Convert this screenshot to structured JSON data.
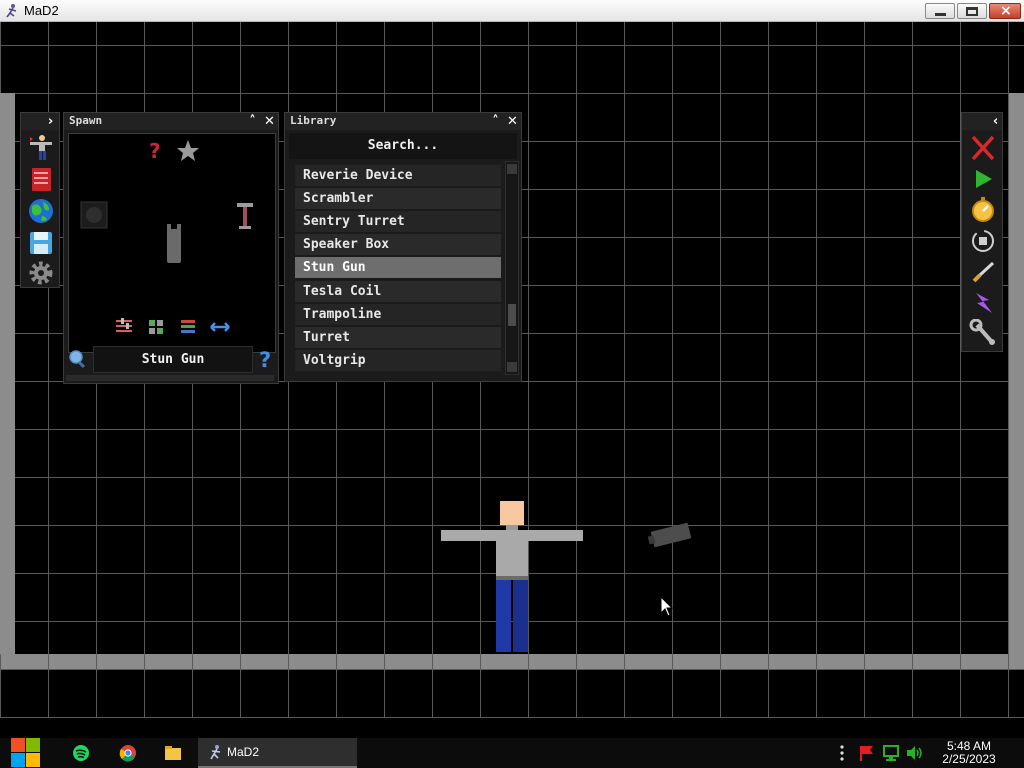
{
  "window": {
    "title": "MaD2"
  },
  "spawn_panel": {
    "title": "Spawn",
    "selected_name": "Stun Gun"
  },
  "library_panel": {
    "title": "Library",
    "search_placeholder": "Search...",
    "items": [
      {
        "label": "Reverie Device"
      },
      {
        "label": "Scrambler"
      },
      {
        "label": "Sentry Turret"
      },
      {
        "label": "Speaker Box"
      },
      {
        "label": "Stun Gun",
        "selected": true
      },
      {
        "label": "Tesla Coil"
      },
      {
        "label": "Trampoline"
      },
      {
        "label": "Turret"
      },
      {
        "label": "Voltgrip"
      }
    ]
  },
  "left_toolbar": {
    "icons": [
      "spawn-person-icon",
      "book-icon",
      "globe-icon",
      "save-icon",
      "settings-gear-icon"
    ]
  },
  "right_toolbar": {
    "icons": [
      "delete-icon",
      "play-icon",
      "stopwatch-icon",
      "record-icon",
      "knife-icon",
      "lightning-icon",
      "wrench-icon"
    ]
  },
  "taskbar": {
    "active_app": "MaD2",
    "time": "5:48 AM",
    "date": "2/25/2023"
  },
  "colors": {
    "grid_line": "#5a5a5a",
    "wall": "#8c8c8c",
    "ragdoll_skin": "#f6c9a0",
    "ragdoll_shirt": "#a9a9a9",
    "ragdoll_pants": "#1f3aa6",
    "selected_item": "#6e6e6e"
  }
}
